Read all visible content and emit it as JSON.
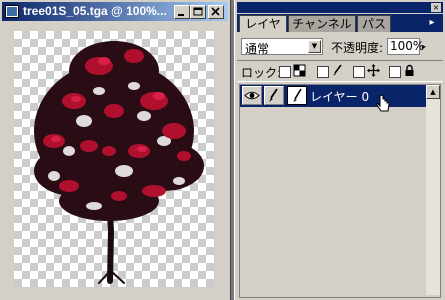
{
  "document": {
    "title": "tree01S_05.tga @ 100%...",
    "buttons": {
      "minimize": "_",
      "maximize": "□",
      "close": "×"
    }
  },
  "palette": {
    "close_glyph": "×",
    "tabs": [
      {
        "label": "レイヤー",
        "active": true
      },
      {
        "label": "チャンネル",
        "active": false
      },
      {
        "label": "パス",
        "active": false
      }
    ],
    "menu_glyph": "▸",
    "blend_mode": "通常",
    "dropdown_glyph": "▼",
    "opacity_label": "不透明度:",
    "opacity_value": "100%",
    "opacity_arrow": "▸",
    "lock_label": "ロック:",
    "lock_icons": [
      "transparency-lock-icon",
      "brush-lock-icon",
      "move-lock-icon",
      "padlock-icon"
    ],
    "layer": {
      "name": "レイヤー 0",
      "visible": true
    },
    "scroll_up_glyph": "▲"
  },
  "colors": {
    "title_active": "#0a246a",
    "title_gradient_end": "#a6caf0",
    "face": "#d4d0c8",
    "workspace": "#7a7a7a",
    "selection": "#0a246a",
    "foliage": "#b0102e"
  }
}
